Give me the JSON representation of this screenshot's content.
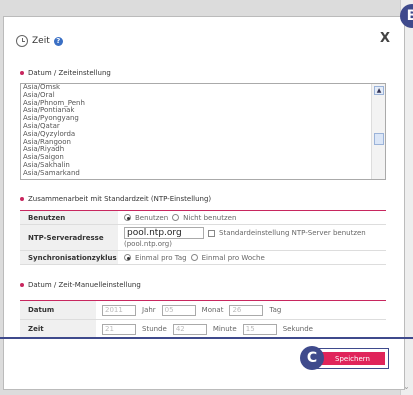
{
  "badges": {
    "b": "B",
    "c": "C"
  },
  "dialog": {
    "title": "Zeit",
    "help_icon": "?",
    "close": "X"
  },
  "sections": {
    "datetime": "Datum / Zeiteinstellung",
    "ntp": "Zusammenarbeit mit Standardzeit (NTP-Einstellung)",
    "manual": "Datum / Zeit-Manuelleinstellung"
  },
  "timezones": [
    "Asia/Omsk",
    "Asia/Oral",
    "Asia/Phnom_Penh",
    "Asia/Pontianak",
    "Asia/Pyongyang",
    "Asia/Qatar",
    "Asia/Qyzylorda",
    "Asia/Rangoon",
    "Asia/Riyadh",
    "Asia/Saigon",
    "Asia/Sakhalin",
    "Asia/Samarkand"
  ],
  "ntp": {
    "use_label": "Benutzen",
    "use_on": "Benutzen",
    "use_off": "Nicht benutzen",
    "server_label": "NTP-Serveradresse",
    "server_value": "pool.ntp.org",
    "server_hint": "(pool.ntp.org)",
    "default_checkbox": "Standardeinstellung NTP-Server benutzen",
    "sync_label": "Synchronisationzyklus",
    "sync_day": "Einmal pro Tag",
    "sync_week": "Einmal pro Woche"
  },
  "manual": {
    "date_label": "Datum",
    "year": "2011",
    "year_unit": "Jahr",
    "month": "05",
    "month_unit": "Monat",
    "day": "26",
    "day_unit": "Tag",
    "time_label": "Zeit",
    "hour": "21",
    "hour_unit": "Stunde",
    "minute": "42",
    "minute_unit": "Minute",
    "second": "15",
    "second_unit": "Sekunde"
  },
  "save_label": "Speichern"
}
